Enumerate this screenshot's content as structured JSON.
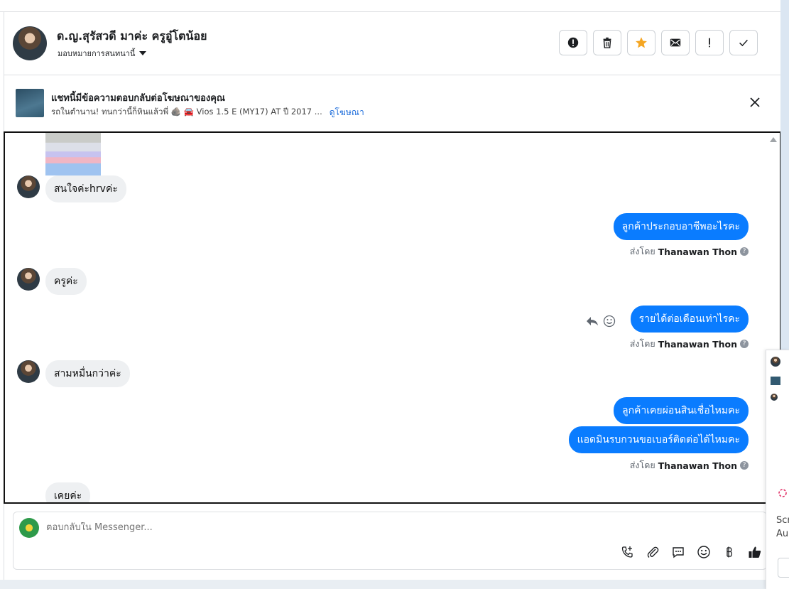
{
  "header": {
    "contact_name": "ด.ญ.สุรัสวดี มาค่ะ ครูอู๋โตน้อย",
    "assign_label": "มอบหมายการสนทนานี้",
    "actions": [
      {
        "name": "report-spam-button",
        "icon": "alert-circle-icon"
      },
      {
        "name": "delete-button",
        "icon": "trash-icon"
      },
      {
        "name": "star-button",
        "icon": "star-icon"
      },
      {
        "name": "mark-unread-button",
        "icon": "envelope-icon"
      },
      {
        "name": "follow-up-button",
        "icon": "exclamation-icon"
      },
      {
        "name": "mark-done-button",
        "icon": "check-icon"
      }
    ],
    "star_color": "#f5a623"
  },
  "ad": {
    "title": "แชทนี้มีข้อความตอบกลับต่อโฆษณาของคุณ",
    "subtitle": "รถในตำนาน! ทนกว่านี้ก็หินแล้วพี่ 🪨 🚘 Vios 1.5 E (MY17) AT ปี 2017 ...",
    "link": "ดูโฆษณา"
  },
  "messages": {
    "m1": "สนใจค่ะhrvค่ะ",
    "m2": "ลูกค้าประกอบอาชีพอะไรคะ",
    "m3": "ครูค่ะ",
    "m4": "รายได้ต่อเดือนเท่าไรคะ",
    "m5": "สามหมื่นกว่าค่ะ",
    "m6": "ลูกค้าเคยผ่อนสินเชื่อไหมคะ",
    "m7": "แอดมินรบกวนขอเบอร์ติดต่อได้ไหมคะ",
    "m8": "เคยค่ะ",
    "sent_by_prefix": "ส่งโดย",
    "sender": "Thanawan Thon",
    "outgoing_color": "#0a7cff"
  },
  "composer": {
    "placeholder": "ตอบกลับใน Messenger..."
  },
  "side_panel": {
    "text1": "Scr",
    "text2": "Au"
  }
}
